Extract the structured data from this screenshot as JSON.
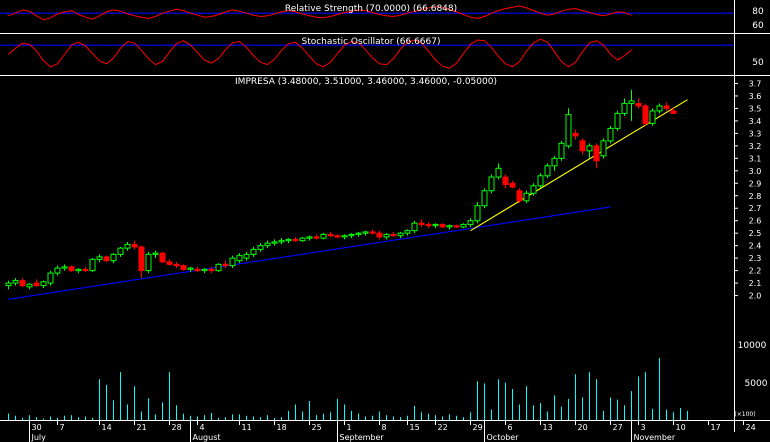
{
  "colors": {
    "background": "#000000",
    "frame": "#ffffff",
    "up_candle": "#00ff00",
    "down_candle": "#ff0000",
    "oscillator_line": "#ff0000",
    "reference_line": "#0000ff",
    "trend_line_long": "#0000ff",
    "trend_line_short": "#ffff00",
    "volume_bars": "#00ffff",
    "text": "#ffffff"
  },
  "panels": {
    "rsi": {
      "title": "Relative Strength (70.0000) (66.6848)",
      "tick_labels": [
        "80",
        "60"
      ],
      "ylim": [
        40,
        90
      ],
      "reference_level": 70,
      "values": [
        66,
        70,
        75,
        73,
        66,
        60,
        63,
        69,
        72,
        74,
        68,
        64,
        61,
        66,
        72,
        75,
        73,
        69,
        66,
        64,
        62,
        65,
        70,
        73,
        76,
        74,
        70,
        67,
        64,
        65,
        68,
        72,
        75,
        73,
        70,
        67,
        65,
        66,
        69,
        72,
        74,
        72,
        69,
        66,
        64,
        63,
        65,
        68,
        71,
        73,
        75,
        74,
        71,
        68,
        66,
        65,
        67,
        70,
        73,
        75,
        78,
        80,
        79,
        76,
        72,
        68,
        64,
        62,
        65,
        70,
        74,
        77,
        79,
        81,
        78,
        74,
        70,
        67,
        69,
        73,
        76,
        77,
        74,
        71,
        68,
        66,
        69,
        72,
        71,
        67
      ]
    },
    "stochastic": {
      "title": "Stochastic Oscillator (66.6667)",
      "tick_labels": [
        "50"
      ],
      "ylim": [
        0,
        110
      ],
      "reference_level": 80,
      "values": [
        55,
        72,
        85,
        82,
        65,
        38,
        22,
        30,
        55,
        80,
        88,
        78,
        58,
        38,
        30,
        45,
        72,
        90,
        86,
        66,
        44,
        28,
        36,
        62,
        84,
        92,
        80,
        60,
        40,
        32,
        44,
        68,
        86,
        90,
        74,
        52,
        34,
        28,
        42,
        66,
        84,
        88,
        72,
        50,
        30,
        22,
        34,
        58,
        80,
        90,
        86,
        68,
        46,
        30,
        28,
        44,
        70,
        88,
        94,
        86,
        64,
        40,
        24,
        18,
        32,
        58,
        82,
        94,
        92,
        74,
        50,
        30,
        22,
        36,
        64,
        86,
        96,
        88,
        62,
        36,
        22,
        34,
        62,
        86,
        92,
        80,
        56,
        40,
        52,
        67
      ]
    },
    "price": {
      "title": "IMPRESA (3.48000, 3.51000, 3.46000, 3.46000, -0.05000)",
      "tick_labels": [
        "3.7",
        "3.6",
        "3.5",
        "3.4",
        "3.3",
        "3.2",
        "3.1",
        "3.0",
        "2.9",
        "2.8",
        "2.7",
        "2.6",
        "2.5",
        "2.4",
        "2.3",
        "2.2",
        "2.1",
        "2.0"
      ],
      "ylim": [
        1.82,
        3.76
      ],
      "trend_lines": [
        {
          "from": [
            0,
            1.97
          ],
          "to": [
            86,
            2.71
          ]
        },
        {
          "from": [
            66,
            2.52
          ],
          "to": [
            97,
            3.57
          ]
        }
      ]
    },
    "volume": {
      "tick_labels": [
        "10000",
        "5000"
      ],
      "ylim": [
        0,
        14500
      ],
      "corner_label": "(×100)"
    }
  },
  "x_axis": {
    "day_labels": [
      {
        "i": 3,
        "text": "30"
      },
      {
        "i": 7,
        "text": "7"
      },
      {
        "i": 13,
        "text": "14"
      },
      {
        "i": 18,
        "text": "21"
      },
      {
        "i": 23,
        "text": "28"
      },
      {
        "i": 27,
        "text": "4"
      },
      {
        "i": 33,
        "text": "11"
      },
      {
        "i": 38,
        "text": "18"
      },
      {
        "i": 43,
        "text": "25"
      },
      {
        "i": 48,
        "text": "1"
      },
      {
        "i": 53,
        "text": "8"
      },
      {
        "i": 57,
        "text": "15"
      },
      {
        "i": 61,
        "text": "22"
      },
      {
        "i": 66,
        "text": "29"
      },
      {
        "i": 71,
        "text": "6"
      },
      {
        "i": 76,
        "text": "13"
      },
      {
        "i": 81,
        "text": "20"
      },
      {
        "i": 86,
        "text": "27"
      },
      {
        "i": 90,
        "text": "3"
      },
      {
        "i": 95,
        "text": "10"
      },
      {
        "i": 100,
        "text": "17"
      },
      {
        "i": 105,
        "text": "24"
      }
    ],
    "month_labels": [
      {
        "i": 3,
        "text": "July"
      },
      {
        "i": 26,
        "text": "August"
      },
      {
        "i": 47,
        "text": "September"
      },
      {
        "i": 68,
        "text": "October"
      },
      {
        "i": 89,
        "text": "November"
      }
    ]
  },
  "chart_data": {
    "type": "candlestick",
    "title": "IMPRESA (3.48000, 3.51000, 3.46000, 3.46000, -0.05000)",
    "ylim": [
      1.82,
      3.76
    ],
    "candles": [
      {
        "o": 2.08,
        "h": 2.12,
        "l": 2.05,
        "c": 2.1
      },
      {
        "o": 2.1,
        "h": 2.14,
        "l": 2.08,
        "c": 2.12
      },
      {
        "o": 2.12,
        "h": 2.14,
        "l": 2.07,
        "c": 2.08
      },
      {
        "o": 2.07,
        "h": 2.1,
        "l": 2.05,
        "c": 2.09
      },
      {
        "o": 2.1,
        "h": 2.13,
        "l": 2.07,
        "c": 2.08
      },
      {
        "o": 2.08,
        "h": 2.12,
        "l": 2.06,
        "c": 2.11
      },
      {
        "o": 2.1,
        "h": 2.2,
        "l": 2.08,
        "c": 2.18
      },
      {
        "o": 2.18,
        "h": 2.24,
        "l": 2.16,
        "c": 2.22
      },
      {
        "o": 2.22,
        "h": 2.25,
        "l": 2.2,
        "c": 2.23
      },
      {
        "o": 2.23,
        "h": 2.24,
        "l": 2.19,
        "c": 2.2
      },
      {
        "o": 2.2,
        "h": 2.22,
        "l": 2.18,
        "c": 2.21
      },
      {
        "o": 2.21,
        "h": 2.23,
        "l": 2.19,
        "c": 2.2
      },
      {
        "o": 2.2,
        "h": 2.3,
        "l": 2.19,
        "c": 2.29
      },
      {
        "o": 2.29,
        "h": 2.33,
        "l": 2.27,
        "c": 2.31
      },
      {
        "o": 2.31,
        "h": 2.32,
        "l": 2.27,
        "c": 2.28
      },
      {
        "o": 2.28,
        "h": 2.34,
        "l": 2.26,
        "c": 2.33
      },
      {
        "o": 2.33,
        "h": 2.39,
        "l": 2.31,
        "c": 2.38
      },
      {
        "o": 2.38,
        "h": 2.43,
        "l": 2.36,
        "c": 2.41
      },
      {
        "o": 2.41,
        "h": 2.44,
        "l": 2.37,
        "c": 2.39
      },
      {
        "o": 2.39,
        "h": 2.4,
        "l": 2.14,
        "c": 2.2
      },
      {
        "o": 2.2,
        "h": 2.35,
        "l": 2.18,
        "c": 2.33
      },
      {
        "o": 2.33,
        "h": 2.36,
        "l": 2.3,
        "c": 2.34
      },
      {
        "o": 2.34,
        "h": 2.35,
        "l": 2.26,
        "c": 2.27
      },
      {
        "o": 2.27,
        "h": 2.29,
        "l": 2.24,
        "c": 2.25
      },
      {
        "o": 2.25,
        "h": 2.27,
        "l": 2.22,
        "c": 2.24
      },
      {
        "o": 2.24,
        "h": 2.25,
        "l": 2.2,
        "c": 2.21
      },
      {
        "o": 2.21,
        "h": 2.23,
        "l": 2.19,
        "c": 2.22
      },
      {
        "o": 2.21,
        "h": 2.23,
        "l": 2.19,
        "c": 2.2
      },
      {
        "o": 2.2,
        "h": 2.22,
        "l": 2.18,
        "c": 2.21
      },
      {
        "o": 2.21,
        "h": 2.23,
        "l": 2.18,
        "c": 2.2
      },
      {
        "o": 2.2,
        "h": 2.26,
        "l": 2.19,
        "c": 2.25
      },
      {
        "o": 2.25,
        "h": 2.28,
        "l": 2.22,
        "c": 2.24
      },
      {
        "o": 2.24,
        "h": 2.32,
        "l": 2.22,
        "c": 2.3
      },
      {
        "o": 2.28,
        "h": 2.34,
        "l": 2.26,
        "c": 2.32
      },
      {
        "o": 2.3,
        "h": 2.35,
        "l": 2.28,
        "c": 2.33
      },
      {
        "o": 2.33,
        "h": 2.39,
        "l": 2.31,
        "c": 2.37
      },
      {
        "o": 2.37,
        "h": 2.42,
        "l": 2.35,
        "c": 2.4
      },
      {
        "o": 2.4,
        "h": 2.44,
        "l": 2.38,
        "c": 2.42
      },
      {
        "o": 2.42,
        "h": 2.45,
        "l": 2.4,
        "c": 2.43
      },
      {
        "o": 2.43,
        "h": 2.46,
        "l": 2.41,
        "c": 2.44
      },
      {
        "o": 2.44,
        "h": 2.46,
        "l": 2.42,
        "c": 2.45
      },
      {
        "o": 2.45,
        "h": 2.47,
        "l": 2.43,
        "c": 2.44
      },
      {
        "o": 2.44,
        "h": 2.47,
        "l": 2.43,
        "c": 2.46
      },
      {
        "o": 2.46,
        "h": 2.48,
        "l": 2.44,
        "c": 2.47
      },
      {
        "o": 2.47,
        "h": 2.49,
        "l": 2.45,
        "c": 2.46
      },
      {
        "o": 2.46,
        "h": 2.5,
        "l": 2.45,
        "c": 2.49
      },
      {
        "o": 2.49,
        "h": 2.51,
        "l": 2.47,
        "c": 2.48
      },
      {
        "o": 2.48,
        "h": 2.49,
        "l": 2.46,
        "c": 2.47
      },
      {
        "o": 2.47,
        "h": 2.49,
        "l": 2.45,
        "c": 2.48
      },
      {
        "o": 2.48,
        "h": 2.5,
        "l": 2.46,
        "c": 2.49
      },
      {
        "o": 2.49,
        "h": 2.51,
        "l": 2.47,
        "c": 2.5
      },
      {
        "o": 2.5,
        "h": 2.52,
        "l": 2.48,
        "c": 2.51
      },
      {
        "o": 2.51,
        "h": 2.53,
        "l": 2.49,
        "c": 2.5
      },
      {
        "o": 2.5,
        "h": 2.52,
        "l": 2.45,
        "c": 2.47
      },
      {
        "o": 2.47,
        "h": 2.5,
        "l": 2.45,
        "c": 2.49
      },
      {
        "o": 2.49,
        "h": 2.51,
        "l": 2.47,
        "c": 2.48
      },
      {
        "o": 2.48,
        "h": 2.51,
        "l": 2.46,
        "c": 2.5
      },
      {
        "o": 2.5,
        "h": 2.53,
        "l": 2.48,
        "c": 2.52
      },
      {
        "o": 2.52,
        "h": 2.6,
        "l": 2.5,
        "c": 2.58
      },
      {
        "o": 2.58,
        "h": 2.61,
        "l": 2.55,
        "c": 2.57
      },
      {
        "o": 2.57,
        "h": 2.59,
        "l": 2.54,
        "c": 2.56
      },
      {
        "o": 2.56,
        "h": 2.58,
        "l": 2.54,
        "c": 2.57
      },
      {
        "o": 2.57,
        "h": 2.58,
        "l": 2.54,
        "c": 2.55
      },
      {
        "o": 2.55,
        "h": 2.57,
        "l": 2.53,
        "c": 2.56
      },
      {
        "o": 2.56,
        "h": 2.57,
        "l": 2.54,
        "c": 2.55
      },
      {
        "o": 2.55,
        "h": 2.58,
        "l": 2.54,
        "c": 2.57
      },
      {
        "o": 2.57,
        "h": 2.62,
        "l": 2.55,
        "c": 2.6
      },
      {
        "o": 2.6,
        "h": 2.75,
        "l": 2.58,
        "c": 2.72
      },
      {
        "o": 2.72,
        "h": 2.86,
        "l": 2.7,
        "c": 2.84
      },
      {
        "o": 2.84,
        "h": 2.97,
        "l": 2.82,
        "c": 2.95
      },
      {
        "o": 2.95,
        "h": 3.06,
        "l": 2.93,
        "c": 3.02
      },
      {
        "o": 2.95,
        "h": 2.97,
        "l": 2.86,
        "c": 2.89
      },
      {
        "o": 2.9,
        "h": 2.92,
        "l": 2.86,
        "c": 2.87
      },
      {
        "o": 2.84,
        "h": 2.86,
        "l": 2.74,
        "c": 2.76
      },
      {
        "o": 2.76,
        "h": 2.84,
        "l": 2.74,
        "c": 2.82
      },
      {
        "o": 2.82,
        "h": 2.9,
        "l": 2.8,
        "c": 2.88
      },
      {
        "o": 2.88,
        "h": 2.98,
        "l": 2.86,
        "c": 2.96
      },
      {
        "o": 2.96,
        "h": 3.06,
        "l": 2.94,
        "c": 3.04
      },
      {
        "o": 3.04,
        "h": 3.12,
        "l": 3.0,
        "c": 3.1
      },
      {
        "o": 3.1,
        "h": 3.24,
        "l": 3.08,
        "c": 3.22
      },
      {
        "o": 3.2,
        "h": 3.5,
        "l": 3.18,
        "c": 3.45
      },
      {
        "o": 3.3,
        "h": 3.33,
        "l": 3.25,
        "c": 3.28
      },
      {
        "o": 3.24,
        "h": 3.26,
        "l": 3.13,
        "c": 3.16
      },
      {
        "o": 3.16,
        "h": 3.22,
        "l": 3.1,
        "c": 3.2
      },
      {
        "o": 3.2,
        "h": 3.22,
        "l": 3.02,
        "c": 3.08
      },
      {
        "o": 3.12,
        "h": 3.26,
        "l": 3.1,
        "c": 3.24
      },
      {
        "o": 3.24,
        "h": 3.36,
        "l": 3.22,
        "c": 3.34
      },
      {
        "o": 3.34,
        "h": 3.48,
        "l": 3.32,
        "c": 3.46
      },
      {
        "o": 3.46,
        "h": 3.58,
        "l": 3.44,
        "c": 3.54
      },
      {
        "o": 3.54,
        "h": 3.65,
        "l": 3.4,
        "c": 3.56
      },
      {
        "o": 3.54,
        "h": 3.58,
        "l": 3.5,
        "c": 3.52
      },
      {
        "o": 3.52,
        "h": 3.54,
        "l": 3.36,
        "c": 3.38
      },
      {
        "o": 3.38,
        "h": 3.5,
        "l": 3.36,
        "c": 3.48
      },
      {
        "o": 3.48,
        "h": 3.54,
        "l": 3.46,
        "c": 3.52
      },
      {
        "o": 3.52,
        "h": 3.55,
        "l": 3.48,
        "c": 3.5
      },
      {
        "o": 3.48,
        "h": 3.51,
        "l": 3.46,
        "c": 3.46
      }
    ],
    "volume": [
      900,
      600,
      300,
      700,
      400,
      200,
      500,
      300,
      600,
      700,
      400,
      500,
      300,
      5800,
      5000,
      2800,
      6800,
      2200,
      4800,
      1200,
      3100,
      800,
      2500,
      6800,
      2100,
      900,
      600,
      500,
      700,
      1000,
      300,
      400,
      800,
      800,
      600,
      500,
      400,
      700,
      300,
      400,
      1300,
      2200,
      1200,
      2700,
      700,
      900,
      1100,
      3000,
      2200,
      1300,
      900,
      500,
      600,
      1200,
      700,
      500,
      400,
      600,
      2000,
      1100,
      900,
      700,
      500,
      800,
      600,
      400,
      1100,
      5500,
      5200,
      1500,
      5800,
      5300,
      4400,
      2200,
      4800,
      2100,
      2400,
      1200,
      3500,
      1900,
      3000,
      6500,
      3200,
      6800,
      5800,
      1300,
      3200,
      2900,
      2100,
      4100,
      6200,
      6800,
      1600,
      8800,
      1500,
      1100,
      1700,
      1300
    ]
  }
}
